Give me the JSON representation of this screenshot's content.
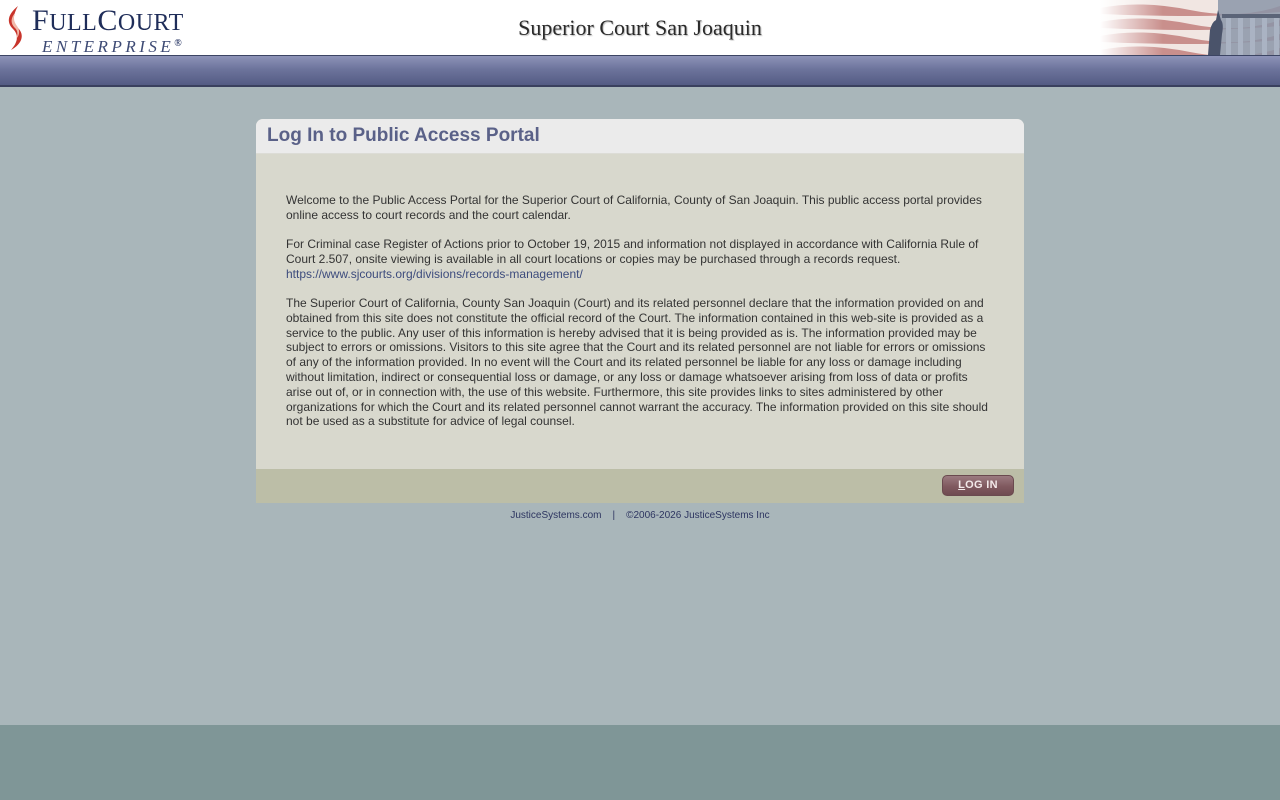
{
  "header": {
    "logo_main_big1": "F",
    "logo_main_small1": "ULL",
    "logo_main_big2": "C",
    "logo_main_small2": "OURT",
    "logo_sub": "ENTERPRISE",
    "logo_reg": "®",
    "court_title": "Superior Court San Joaquin"
  },
  "panel": {
    "title": "Log In to Public Access Portal",
    "paragraph1": "Welcome to the Public Access Portal for the Superior Court of California, County of San Joaquin. This public access portal provides online access to court records and the court calendar.",
    "paragraph2": "For Criminal case Register of Actions prior to October 19, 2015 and information not displayed in accordance with California Rule of Court 2.507, onsite viewing is available in all court locations or copies may be purchased through a records request.",
    "records_link": "https://www.sjcourts.org/divisions/records-management/",
    "paragraph3": "The Superior Court of California, County San Joaquin (Court) and its related personnel declare that the information provided on and obtained from this site does not constitute the official record of the Court. The information contained in this web-site is provided as a service to the public. Any user of this information is hereby advised that it is being provided as is. The information provided may be subject to errors or omissions. Visitors to this site agree that the Court and its related personnel are not liable for errors or omissions of any of the information provided. In no event will the Court and its related personnel be liable for any loss or damage including without limitation, indirect or consequential loss or damage, or any loss or damage whatsoever arising from loss of data or profits arise out of, or in connection with, the use of this website. Furthermore, this site provides links to sites administered by other organizations for which the Court and its related personnel cannot warrant the accuracy. The information provided on this site should not be used as a substitute for advice of legal counsel.",
    "login_first": "L",
    "login_rest": "OG IN"
  },
  "footer": {
    "site_link": "JusticeSystems.com",
    "separator": "|",
    "copyright": "©2006-2026 JusticeSystems Inc"
  },
  "colors": {
    "background": "#a9b6ba",
    "navbar": "#6d749c",
    "panel_body": "#d8d8cd",
    "panel_footer": "#bcbea7",
    "title_text": "#5a6188",
    "login_button": "#80595f",
    "bottom_band": "#7f9697"
  },
  "icons": {
    "logo_flame": "flame-s-logo-icon",
    "header_art": "flag-and-courthouse-icon"
  }
}
